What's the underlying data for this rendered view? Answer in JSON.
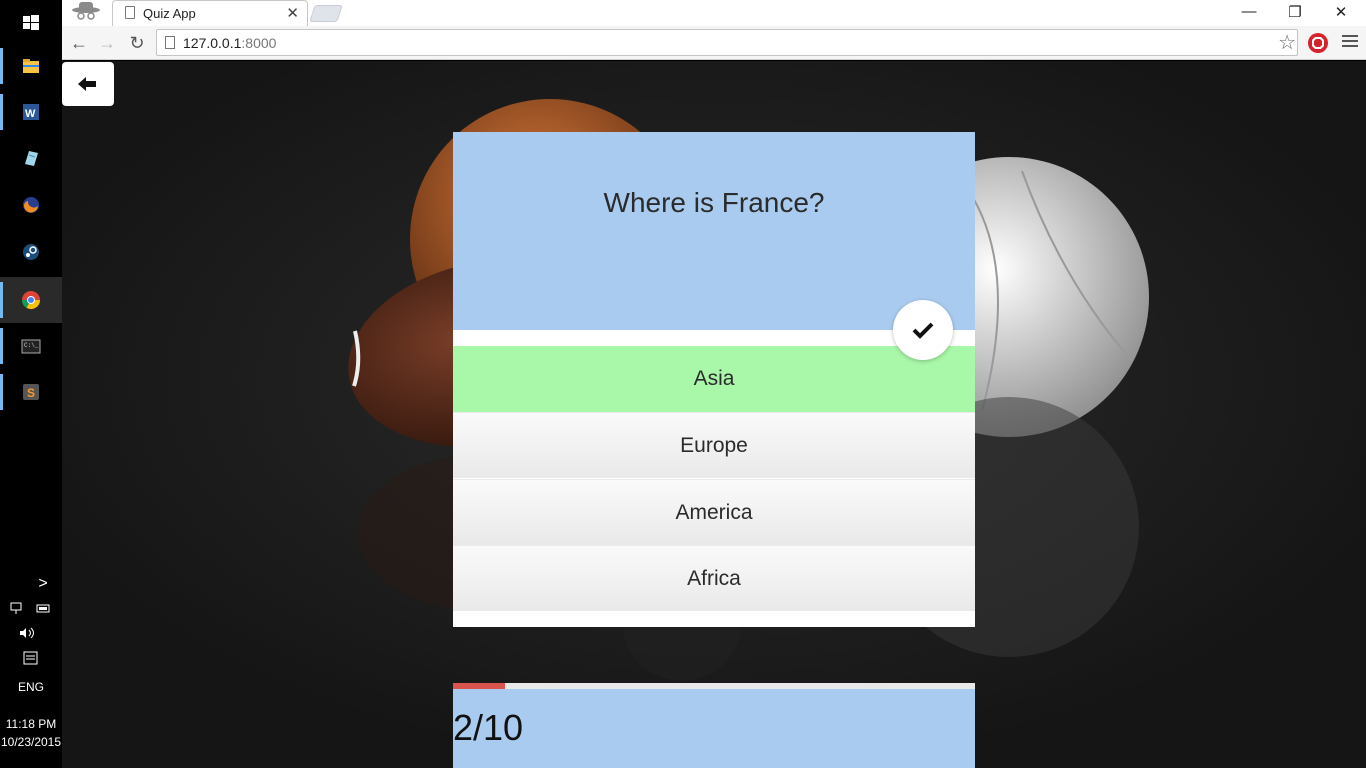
{
  "taskbar": {
    "apps": [
      "start-icon",
      "file-explorer-icon",
      "word-icon",
      "notepad-icon",
      "firefox-icon",
      "steam-icon",
      "chrome-icon",
      "terminal-icon",
      "sublime-icon"
    ],
    "tray": {
      "language": "ENG",
      "time": "11:18 PM",
      "date": "10/23/2015"
    }
  },
  "browser": {
    "tab_title": "Quiz App",
    "address_host": "127.0.0.1",
    "address_port": ":8000",
    "ext_label": "●"
  },
  "quiz": {
    "question": "Where is France?",
    "answers": [
      {
        "label": "Asia",
        "state": "correct"
      },
      {
        "label": "Europe",
        "state": "normal"
      },
      {
        "label": "America",
        "state": "normal"
      },
      {
        "label": "Africa",
        "state": "normal"
      }
    ],
    "progress_text": "2/10",
    "progress_fraction": 0.1
  },
  "colors": {
    "question_bg": "#aacbf0",
    "correct_bg": "#a9f7a9",
    "progress_fill": "#d9534f"
  }
}
